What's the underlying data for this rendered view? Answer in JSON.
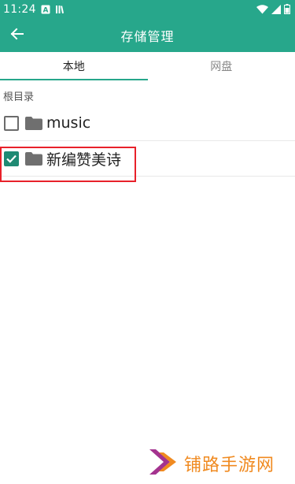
{
  "status_bar": {
    "time": "11:24"
  },
  "header": {
    "title": "存储管理",
    "back_icon": "arrow-left-icon"
  },
  "tabs": [
    {
      "label": "本地",
      "active": true
    },
    {
      "label": "网盘",
      "active": false
    }
  ],
  "path": "根目录",
  "items": [
    {
      "name": "music",
      "checked": false
    },
    {
      "name": "新编赞美诗",
      "checked": true
    }
  ],
  "watermark": {
    "text": "铺路手游网"
  },
  "colors": {
    "primary": "#27a78b",
    "check": "#1f8a73",
    "highlight": "#e8212a",
    "watermark": "#f08a20"
  }
}
